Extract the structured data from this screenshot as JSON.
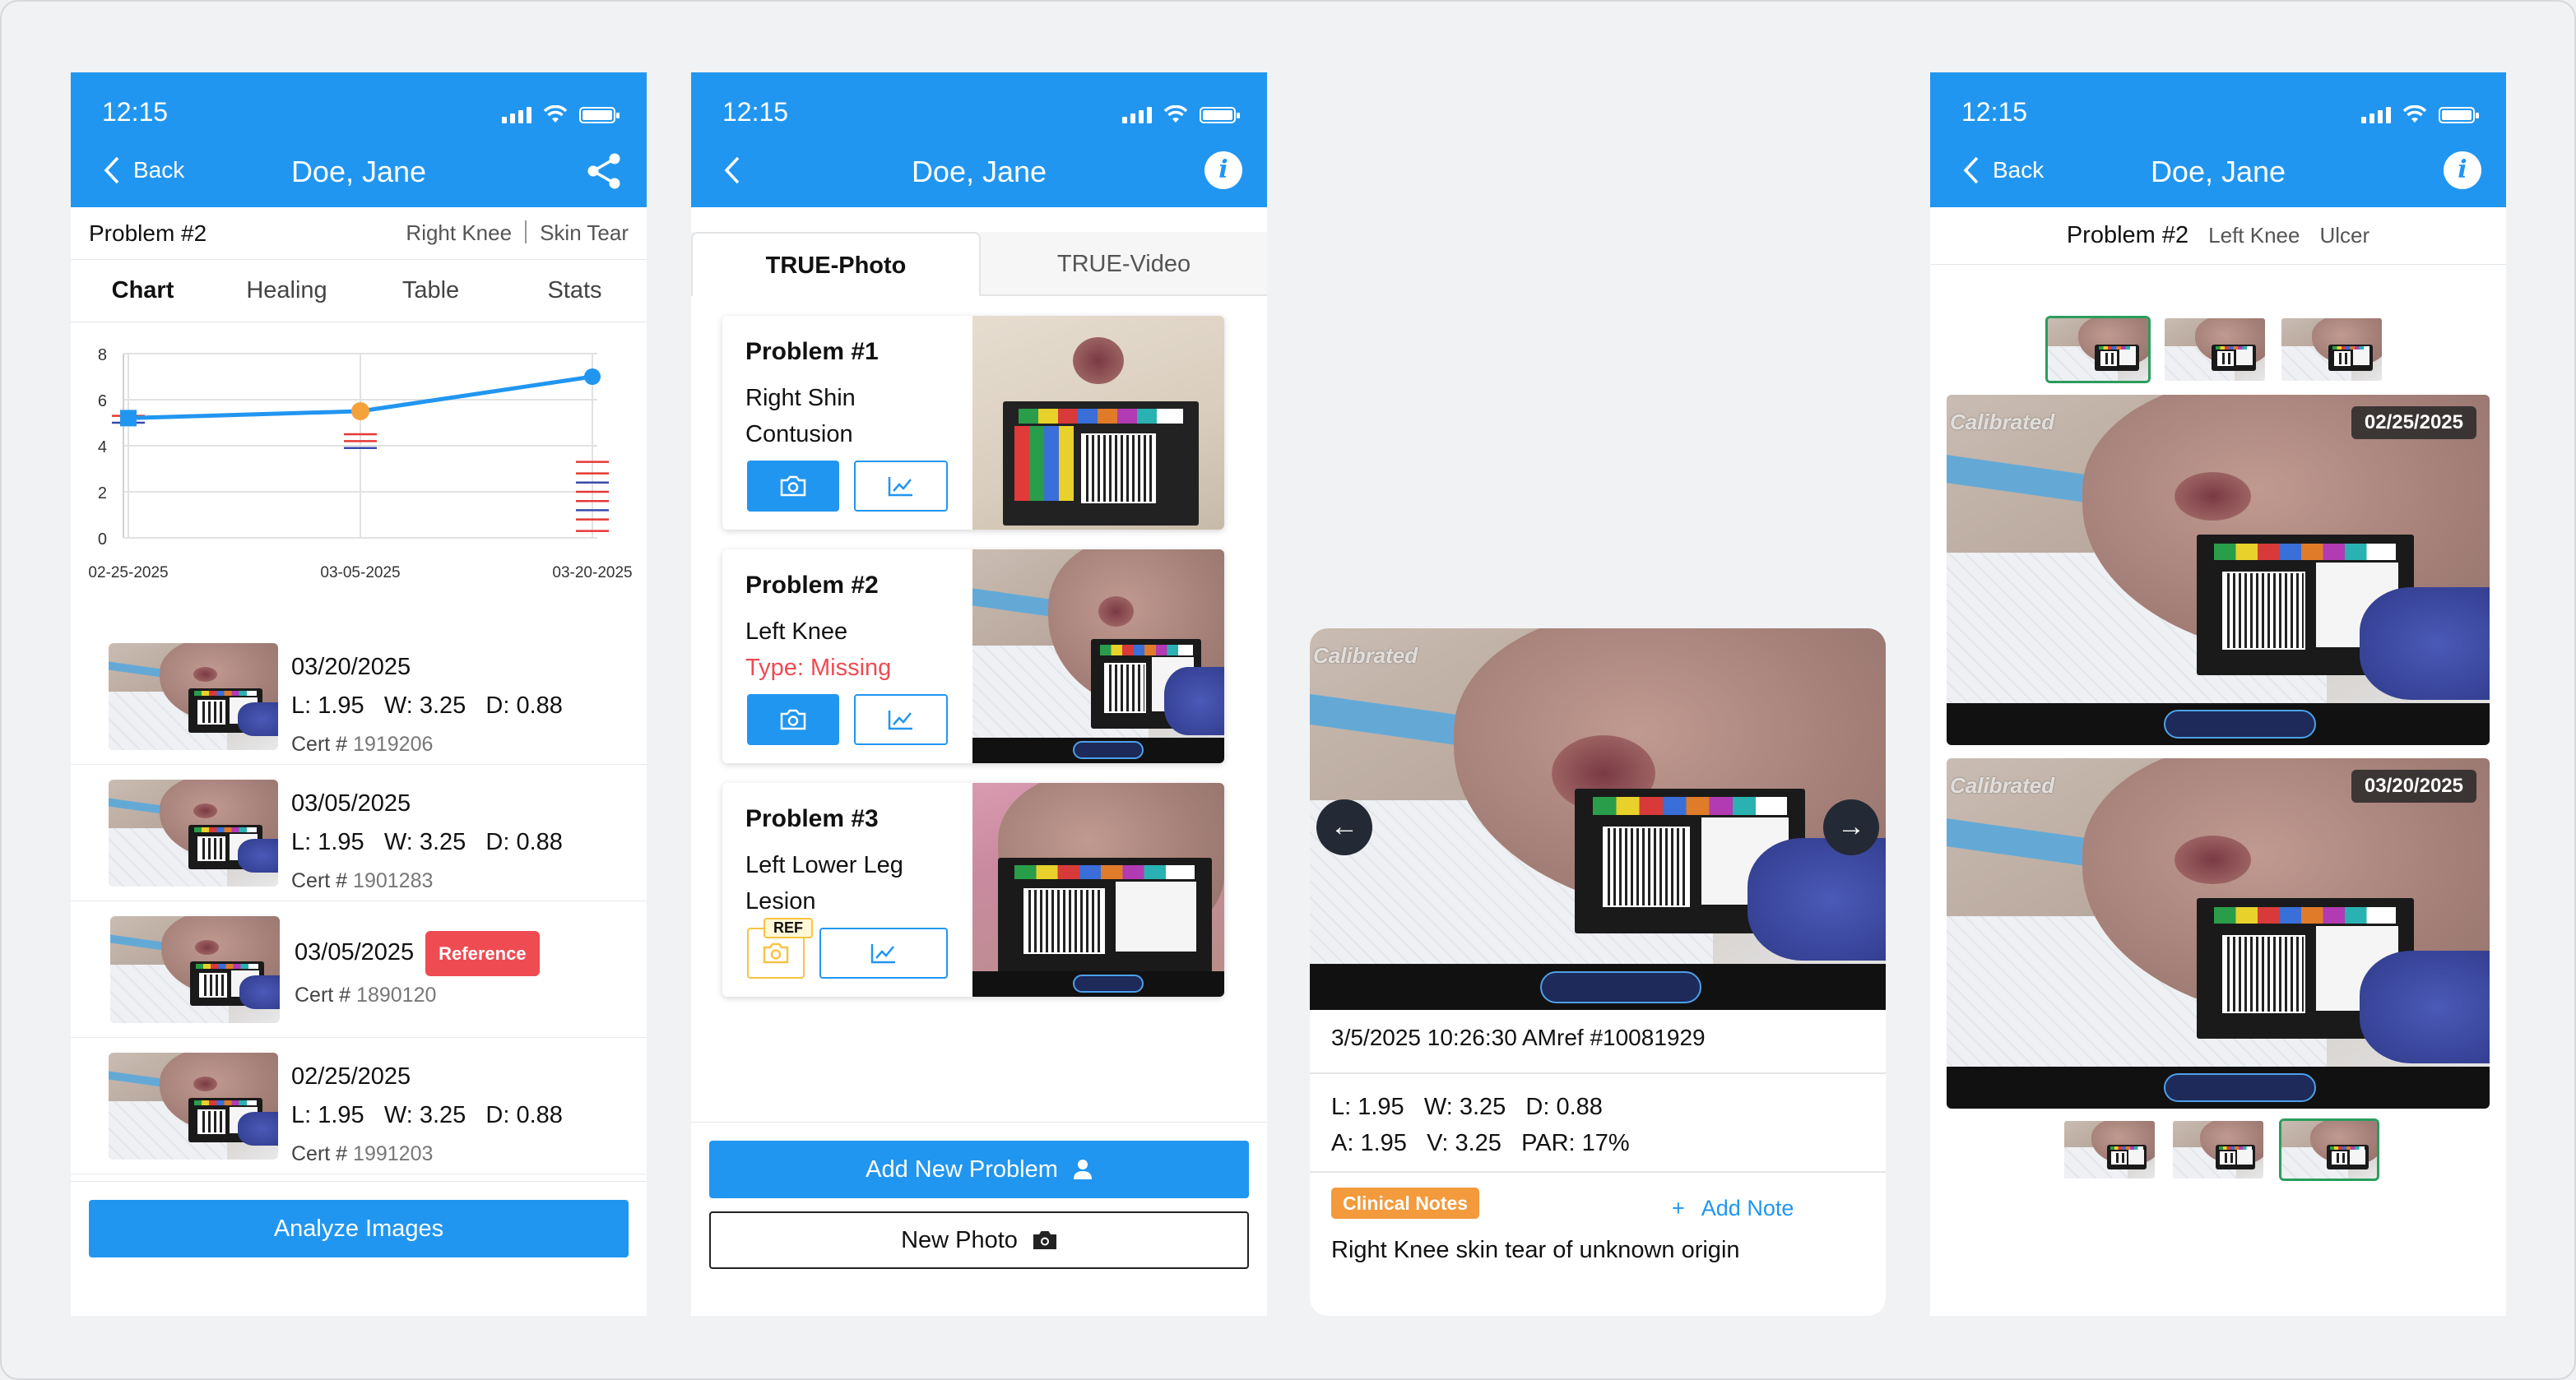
{
  "status": {
    "time": "12:15"
  },
  "screen1": {
    "nav": {
      "back_label": "Back",
      "title": "Doe, Jane"
    },
    "problem": {
      "title": "Problem #2",
      "location": "Right Knee",
      "type": "Skin Tear"
    },
    "tabs": [
      "Chart",
      "Healing",
      "Table",
      "Stats"
    ],
    "chart_data": {
      "type": "line",
      "categories": [
        "02-25-2025",
        "03-05-2025",
        "03-20-2025"
      ],
      "values": [
        5.2,
        5.5,
        7.0
      ],
      "yticks": [
        "8",
        "6",
        "4",
        "2",
        "0"
      ],
      "ylim": [
        0,
        8
      ],
      "point_colors": [
        "#2196f0",
        "#f5a23a",
        "#2196f0"
      ]
    },
    "records": [
      {
        "date": "03/20/2025",
        "measure": "L: 1.95   W: 3.25   D: 0.88",
        "cert_label": "Cert #",
        "cert": "1919206"
      },
      {
        "date": "03/05/2025",
        "measure": "L: 1.95   W: 3.25   D: 0.88",
        "cert_label": "Cert #",
        "cert": "1901283"
      },
      {
        "date": "03/05/2025",
        "badge": "Reference",
        "cert_label": "Cert #",
        "cert": "1890120"
      },
      {
        "date": "02/25/2025",
        "measure": "L: 1.95   W: 3.25   D: 0.88",
        "cert_label": "Cert #",
        "cert": "1991203"
      }
    ],
    "analyze_button": "Analyze Images"
  },
  "screen2": {
    "nav": {
      "title": "Doe, Jane"
    },
    "tabs": [
      "TRUE-Photo",
      "TRUE-Video"
    ],
    "problems": [
      {
        "title": "Problem #1",
        "desc": "Right Shin Contusion"
      },
      {
        "title": "Problem #2",
        "desc": "Left Knee",
        "warning": "Type: Missing"
      },
      {
        "title": "Problem #3",
        "desc": "Left Lower Leg Lesion",
        "ref": "REF"
      }
    ],
    "add_problem_button": "Add New Problem",
    "new_photo_button": "New Photo"
  },
  "screen3": {
    "watermark": "Calibrated",
    "timestamp": "3/5/2025  10:26:30 AMref #10081929",
    "measure_line1": "L: 1.95   W: 3.25   D: 0.88",
    "measure_line2": "A: 1.95   V: 3.25   PAR: 17%",
    "notes_tag": "Clinical Notes",
    "add_note": "Add Note",
    "note_text": "Right Knee skin tear of unknown origin"
  },
  "screen4": {
    "nav": {
      "back_label": "Back",
      "title": "Doe, Jane"
    },
    "problem": {
      "title": "Problem #2",
      "location": "Left Knee",
      "type": "Ulcer"
    },
    "watermark": "Calibrated",
    "dates": [
      "02/25/2025",
      "03/20/2025"
    ]
  },
  "colors": {
    "primary": "#2196f0",
    "reference": "#ef4b53",
    "notes": "#f39a3d",
    "selected": "#2a9d5c"
  }
}
